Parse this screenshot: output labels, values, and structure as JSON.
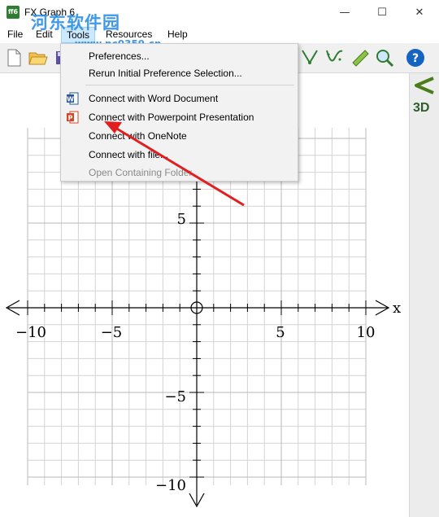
{
  "window": {
    "title": "FX Graph 6",
    "app_icon_text": "ff6",
    "minimize_glyph": "—",
    "maximize_glyph": "☐",
    "close_glyph": "✕"
  },
  "watermark": {
    "site_name": "河东软件园",
    "url": "www.pc0359.cn"
  },
  "menubar": {
    "items": [
      "File",
      "Edit",
      "Tools",
      "Resources",
      "Help"
    ],
    "open_item": "Tools"
  },
  "tools_menu": {
    "items": [
      {
        "label": "Preferences...",
        "icon": "",
        "enabled": true
      },
      {
        "label": "Rerun Initial Preference Selection...",
        "icon": "",
        "enabled": true
      },
      {
        "label": "Connect with Word Document",
        "icon": "word-icon",
        "enabled": true
      },
      {
        "label": "Connect with Powerpoint Presentation",
        "icon": "powerpoint-icon",
        "enabled": true
      },
      {
        "label": "Connect with OneNote",
        "icon": "",
        "enabled": true
      },
      {
        "label": "Connect with file...",
        "icon": "",
        "enabled": true
      },
      {
        "label": "Open Containing Folder",
        "icon": "",
        "enabled": false
      }
    ],
    "word_icon_letter": "W",
    "powerpoint_icon_letter": "P"
  },
  "toolbar": {
    "icons": [
      "new-file-icon",
      "open-folder-icon",
      "save-icon",
      "line-tool-icon",
      "curve-tool-icon",
      "ruler-icon",
      "magnify-icon",
      "help-icon"
    ],
    "help_glyph": "?"
  },
  "sidepanel": {
    "collapse_glyph": "<",
    "mode_label": "3D"
  },
  "graph": {
    "x_axis_label": "x",
    "x_tick_labels": [
      "−10",
      "−5",
      "5",
      "10"
    ],
    "y_tick_labels": [
      "5",
      "−5",
      "−10"
    ],
    "grid": true,
    "colors": {
      "grid": "#d4d4d4",
      "grid_major": "#b8b8b8",
      "axis": "#000000"
    }
  },
  "annotation": {
    "arrow_color": "#e02020"
  }
}
